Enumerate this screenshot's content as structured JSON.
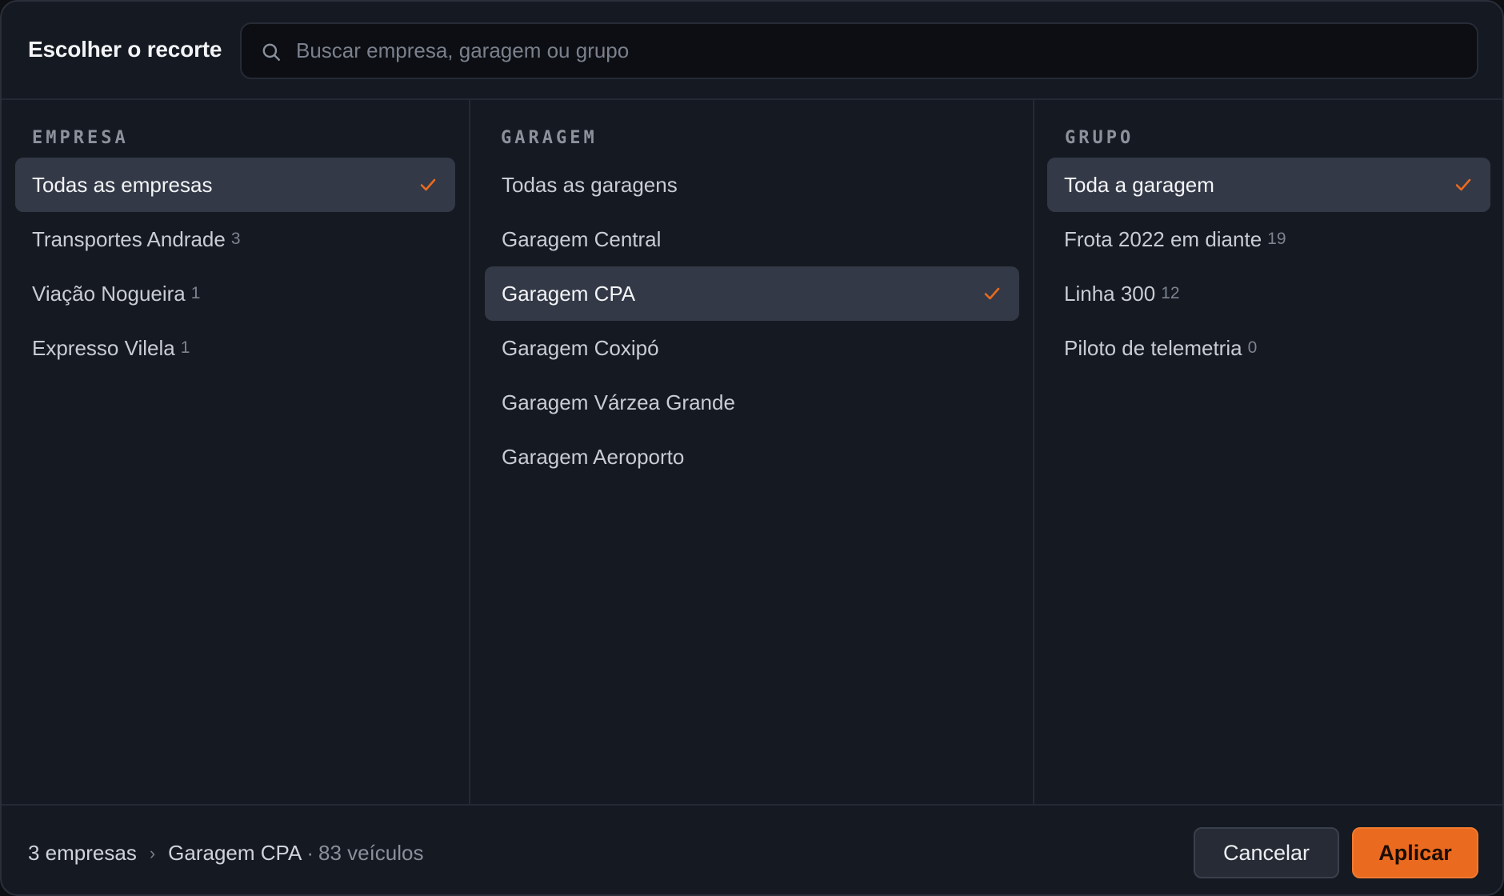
{
  "header": {
    "title": "Escolher o recorte",
    "search": {
      "placeholder": "Buscar empresa, garagem ou grupo",
      "value": ""
    }
  },
  "columns": {
    "empresa": {
      "heading": "EMPRESA",
      "items": [
        {
          "label": "Todas as empresas",
          "count": "",
          "selected": true
        },
        {
          "label": "Transportes Andrade",
          "count": "3",
          "selected": false
        },
        {
          "label": "Viação Nogueira",
          "count": "1",
          "selected": false
        },
        {
          "label": "Expresso Vilela",
          "count": "1",
          "selected": false
        }
      ]
    },
    "garagem": {
      "heading": "GARAGEM",
      "items": [
        {
          "label": "Todas as garagens",
          "count": "",
          "selected": false
        },
        {
          "label": "Garagem Central",
          "count": "",
          "selected": false
        },
        {
          "label": "Garagem CPA",
          "count": "",
          "selected": true
        },
        {
          "label": "Garagem Coxipó",
          "count": "",
          "selected": false
        },
        {
          "label": "Garagem Várzea Grande",
          "count": "",
          "selected": false
        },
        {
          "label": "Garagem Aeroporto",
          "count": "",
          "selected": false
        }
      ]
    },
    "grupo": {
      "heading": "GRUPO",
      "items": [
        {
          "label": "Toda a garagem",
          "count": "",
          "selected": true
        },
        {
          "label": "Frota 2022 em diante",
          "count": "19",
          "selected": false
        },
        {
          "label": "Linha 300",
          "count": "12",
          "selected": false
        },
        {
          "label": "Piloto de telemetria",
          "count": "0",
          "selected": false
        }
      ]
    }
  },
  "footer": {
    "summary_empresas": "3 empresas",
    "summary_separator": "›",
    "summary_garagem": "Garagem CPA",
    "summary_dot": "·",
    "summary_veiculos": "83 veículos",
    "cancel_label": "Cancelar",
    "apply_label": "Aplicar"
  },
  "colors": {
    "accent": "#ea6a1f",
    "panel": "#151921",
    "selected_row": "#333946"
  },
  "icons": {
    "search": "search-icon",
    "check": "check-icon"
  }
}
